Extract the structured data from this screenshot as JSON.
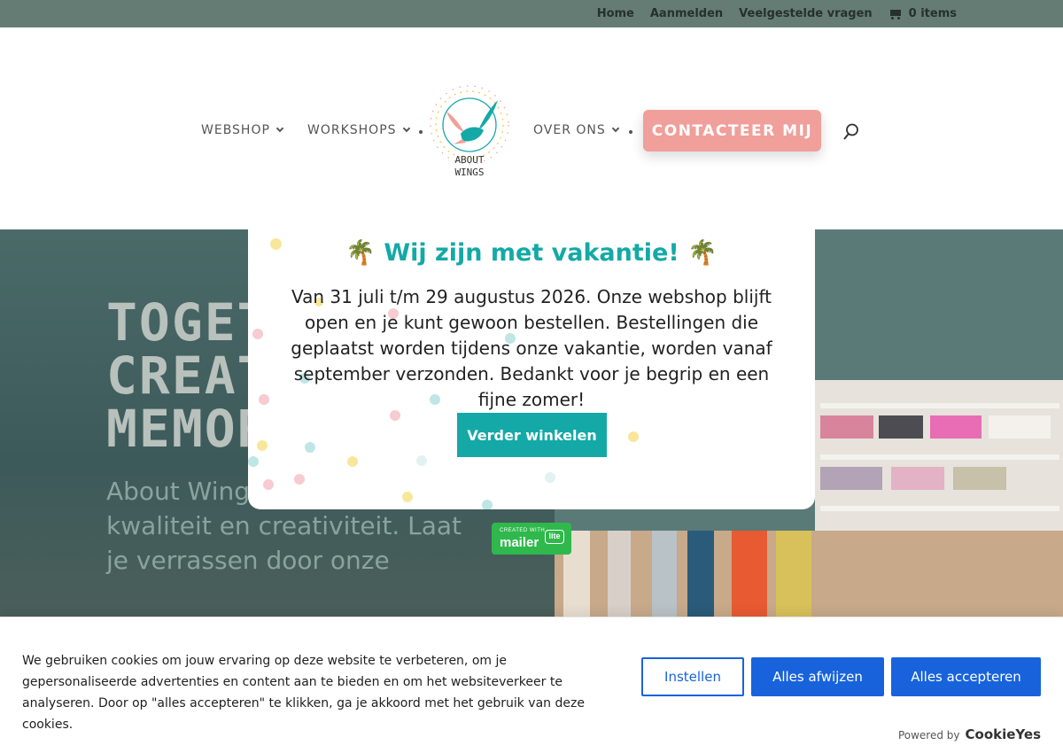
{
  "topbar": {
    "home": "Home",
    "login": "Aanmelden",
    "faq": "Veelgestelde vragen",
    "cart": "0 items"
  },
  "nav": {
    "webshop": "WEBSHOP",
    "workshops": "WORKSHOPS",
    "about": "OVER ONS",
    "contact": "CONTACTEER MIJ",
    "logo_line1": "ABOUT",
    "logo_line2": "WINGS"
  },
  "hero": {
    "title_line1": "TOGETH",
    "title_line2": "CREATE",
    "title_line3": "MEMOR",
    "text": "About Wing vol karakter, kwaliteit en creativiteit. Laat je verrassen door onze"
  },
  "popup": {
    "title": "Wij zijn met vakantie!",
    "palm": "🌴",
    "body": "Van 31 juli t/m 29 augustus 2026. Onze webshop blijft open en je kunt gewoon bestellen. Bestellingen die geplaatst worden tijdens onze vakantie, worden vanaf september verzonden. Bedankt voor je begrip en een fijne zomer!",
    "button": "Verder winkelen"
  },
  "mailerlite": {
    "small": "CREATED WITH",
    "big": "mailer",
    "lite": "lite"
  },
  "cookie": {
    "text": "We gebruiken cookies om jouw ervaring op deze website te verbeteren, om je gepersonaliseerde advertenties en content aan te bieden en om het websiteverkeer te analyseren. Door op \"alles accepteren\" te klikken, ga je akkoord met het gebruik van deze cookies.",
    "settings": "Instellen",
    "reject": "Alles afwijzen",
    "accept": "Alles accepteren",
    "powered_by": "Powered by",
    "brand": "CookieYes"
  },
  "colors": {
    "topbar": "#657c75",
    "cta": "#f09f9a",
    "teal": "#14a9a7",
    "cookie_blue": "#1863dc"
  }
}
